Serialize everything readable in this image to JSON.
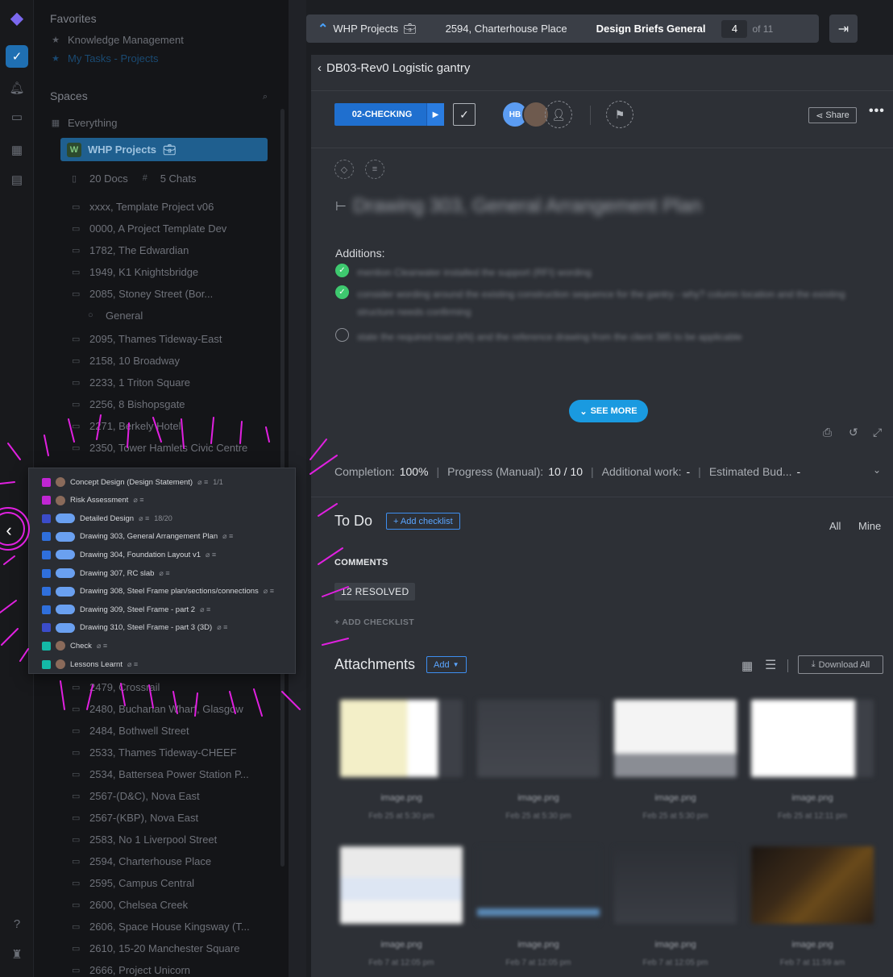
{
  "rail": {
    "logo_icon": "clickup-logo",
    "items": [
      "home-icon",
      "bell-icon",
      "inbox-icon",
      "apps-icon",
      "docs-icon"
    ],
    "bottom": [
      "help-icon",
      "trophy-icon"
    ]
  },
  "sidebar": {
    "favorites_heading": "Favorites",
    "favorites": [
      "Knowledge Management",
      "My Tasks - Projects"
    ],
    "spaces_heading": "Spaces",
    "everything": "Everything",
    "space_name": "WHP Projects",
    "docs": "20 Docs",
    "chats": "5 Chats",
    "projects_before_popup": [
      "xxxx, Template Project v06",
      "0000, A Project Template Dev",
      "1782, The Edwardian",
      "1949, K1 Knightsbridge",
      "2085, Stoney Street (Bor...",
      "General",
      "2095, Thames Tideway-East",
      "2158, 10 Broadway",
      "2233, 1 Triton Square",
      "2256, 8 Bishopsgate",
      "2271, Berkely Hotel",
      "2350, Tower Hamlets Civic Centre"
    ],
    "projects_after_popup": [
      "2479, Crossrail",
      "2480, Buchanan Wharf, Glasgow",
      "2484, Bothwell Street",
      "2533, Thames Tideway-CHEEF",
      "2534, Battersea Power Station P...",
      "2567-(D&C), Nova East",
      "2567-(KBP), Nova East",
      "2583, No 1 Liverpool Street",
      "2594, Charterhouse Place",
      "2595, Campus Central",
      "2600, Chelsea Creek",
      "2606, Space House Kingsway (T...",
      "2610, 15-20 Manchester Square",
      "2666, Project Unicorn"
    ]
  },
  "popup": {
    "items": [
      {
        "label": "Concept Design (Design Statement)",
        "meta": "1/1",
        "color": "#c026d3"
      },
      {
        "label": "Risk Assessment",
        "meta": "",
        "color": "#c026d3"
      },
      {
        "label": "Detailed Design",
        "meta": "18/20",
        "color": "#3b4cca"
      },
      {
        "label": "Drawing 303, General Arrangement Plan",
        "meta": "",
        "color": "#2f6fdc"
      },
      {
        "label": "Drawing 304, Foundation Layout v1",
        "meta": "",
        "color": "#2f6fdc"
      },
      {
        "label": "Drawing 307, RC slab",
        "meta": "",
        "color": "#2f6fdc"
      },
      {
        "label": "Drawing 308, Steel Frame plan/sections/connections",
        "meta": "",
        "color": "#2f6fdc"
      },
      {
        "label": "Drawing 309, Steel Frame - part 2",
        "meta": "",
        "color": "#2f6fdc"
      },
      {
        "label": "Drawing 310, Steel Frame - part 3 (3D)",
        "meta": "",
        "color": "#3b4cca"
      },
      {
        "label": "Check",
        "meta": "",
        "color": "#14b8a6"
      },
      {
        "label": "Lessons Learnt",
        "meta": "",
        "color": "#14b8a6"
      }
    ]
  },
  "topbar": {
    "crumbs": [
      "WHP Projects",
      "2594, Charterhouse Place",
      "Design Briefs General"
    ],
    "page_current": "4",
    "page_total": "of 11"
  },
  "task": {
    "back_title": "DB03-Rev0 Logistic gantry",
    "status": "02-CHECKING",
    "assignee_initials": "HB",
    "share_label": "Share",
    "title": "Drawing 303, General Arrangement Plan",
    "additions_label": "Additions:",
    "checklist": [
      {
        "done": true,
        "text": "mention Clearwater installed the support (RFI) wording"
      },
      {
        "done": true,
        "text": "consider wording around the existing construction sequence for the gantry - why? column location and the existing structure needs confirming"
      },
      {
        "done": false,
        "text": "state the required load (kN) and the reference drawing from the client 385 to be applicable"
      }
    ],
    "see_more": "SEE MORE",
    "fields": [
      {
        "label": "Completion:",
        "value": "100%"
      },
      {
        "label": "Progress (Manual):",
        "value": "10 / 10"
      },
      {
        "label": "Additional work:",
        "value": "-"
      },
      {
        "label": "Estimated Bud...",
        "value": "-"
      }
    ],
    "todo_heading": "To Do",
    "add_checklist_btn": "+ Add checklist",
    "filter_all": "All",
    "filter_mine": "Mine",
    "comments_heading": "COMMENTS",
    "resolved": "12 RESOLVED",
    "add_checklist_link": "+ ADD CHECKLIST",
    "attachments_heading": "Attachments",
    "attachments_add": "Add",
    "download_all": "Download All",
    "attachments": [
      {
        "name": "image.png",
        "date": "Feb 25 at 5:30 pm"
      },
      {
        "name": "image.png",
        "date": "Feb 25 at 5:30 pm"
      },
      {
        "name": "image.png",
        "date": "Feb 25 at 5:30 pm"
      },
      {
        "name": "image.png",
        "date": "Feb 25 at 12:11 pm"
      },
      {
        "name": "image.png",
        "date": "Feb 7 at 12:05 pm"
      },
      {
        "name": "image.png",
        "date": "Feb 7 at 12:05 pm"
      },
      {
        "name": "image.png",
        "date": "Feb 7 at 12:05 pm"
      },
      {
        "name": "image.png",
        "date": "Feb 7 at 11:59 am"
      }
    ]
  },
  "colors": {
    "accent": "#1f6fcf",
    "annotation": "#e020e0",
    "done_green": "#3ec96f"
  }
}
